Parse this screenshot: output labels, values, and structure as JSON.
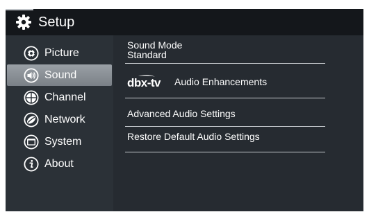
{
  "header": {
    "title": "Setup",
    "icon": "gear-icon"
  },
  "sidebar": {
    "items": [
      {
        "label": "Picture",
        "icon": "picture-icon",
        "selected": false
      },
      {
        "label": "Sound",
        "icon": "speaker-icon",
        "selected": true
      },
      {
        "label": "Channel",
        "icon": "channel-grid-icon",
        "selected": false
      },
      {
        "label": "Network",
        "icon": "network-icon",
        "selected": false
      },
      {
        "label": "System",
        "icon": "system-icon",
        "selected": false
      },
      {
        "label": "About",
        "icon": "info-icon",
        "selected": false
      }
    ]
  },
  "sound": {
    "mode_label": "Sound Mode",
    "mode_value": "Standard",
    "enhancements_logo": "dbx-tv",
    "enhancements_label": "Audio Enhancements",
    "advanced_label": "Advanced Audio Settings",
    "restore_label": "Restore Default Audio Settings"
  },
  "colors": {
    "header_bg": "#14171b",
    "sidebar_bg": "#2b3137",
    "content_bg": "#262b31",
    "selected_bg": "#8a9097",
    "text": "#ffffff",
    "divider": "#c9cdd1"
  }
}
